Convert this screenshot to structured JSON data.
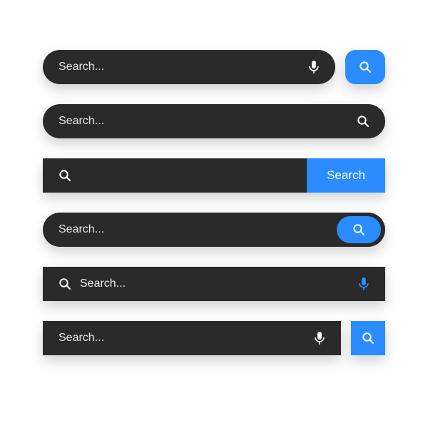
{
  "colors": {
    "bar": "#2a2a2a",
    "accent": "#2a8cff",
    "text": "#ffffff"
  },
  "rows": {
    "r1": {
      "placeholder": "Search..."
    },
    "r2": {
      "placeholder": "Search..."
    },
    "r3": {
      "button_label": "Search"
    },
    "r4": {
      "placeholder": "Search..."
    },
    "r5": {
      "placeholder": "Search..."
    },
    "r6": {
      "placeholder": "Search..."
    }
  }
}
